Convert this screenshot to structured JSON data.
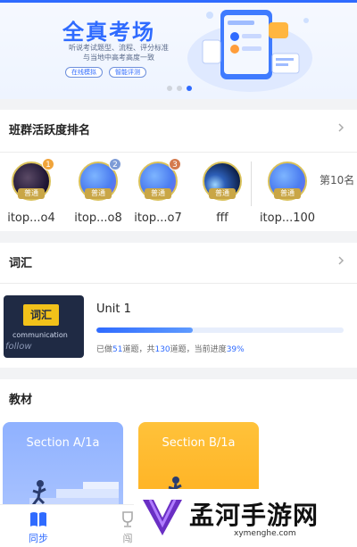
{
  "banner": {
    "title": "全真考场",
    "subtitle_lines": [
      "听说考试题型、流程、评分标准",
      "与当地中高考高度一致"
    ],
    "pills": [
      "在线模拟",
      "智能评测"
    ],
    "carousel_active_index": 2,
    "carousel_count": 3
  },
  "ranking": {
    "title": "班群活跃度排名",
    "members": [
      {
        "name": "itop...o4",
        "tag": "普通",
        "rank": "1",
        "rank_color": "gold",
        "avatar_style": "dark"
      },
      {
        "name": "itop...o8",
        "tag": "普通",
        "rank": "2",
        "rank_color": "silver",
        "avatar_style": "blue"
      },
      {
        "name": "itop...o7",
        "tag": "普通",
        "rank": "3",
        "rank_color": "bronze",
        "avatar_style": "blue"
      },
      {
        "name": "fff",
        "tag": "普通",
        "rank": "",
        "rank_color": "",
        "avatar_style": "space"
      },
      {
        "name": "itop...100",
        "tag": "普通",
        "rank": "",
        "rank_color": "",
        "avatar_style": "blue"
      }
    ],
    "my_rank": "第10名"
  },
  "vocab": {
    "title": "词汇",
    "cover_tag": "词汇",
    "cover_words": [
      "communication",
      "follow"
    ],
    "unit_title": "Unit 1",
    "progress_fraction": 0.39,
    "progress_prefix": "已做",
    "done_count": "51",
    "progress_mid": "道题，共",
    "total_count": "130",
    "progress_suffix": "道题，当前进度",
    "progress_percent": "39%"
  },
  "books": {
    "title": "教材",
    "items": [
      {
        "title": "Section A/1a"
      },
      {
        "title": "Section B/1a"
      }
    ]
  },
  "nav": {
    "items": [
      {
        "label": "同步",
        "icon": "book-icon",
        "active": true
      },
      {
        "label": "闯",
        "icon": "trophy-icon",
        "active": false
      }
    ],
    "active_color": "#2f6bff"
  },
  "watermark": {
    "title": "孟河手游网",
    "url": "xymenghe.com"
  },
  "colors": {
    "accent": "#2f6bff",
    "badge_gold": "#c9a646",
    "book_blue": "#8fb1ff",
    "book_yellow": "#ffb020"
  }
}
